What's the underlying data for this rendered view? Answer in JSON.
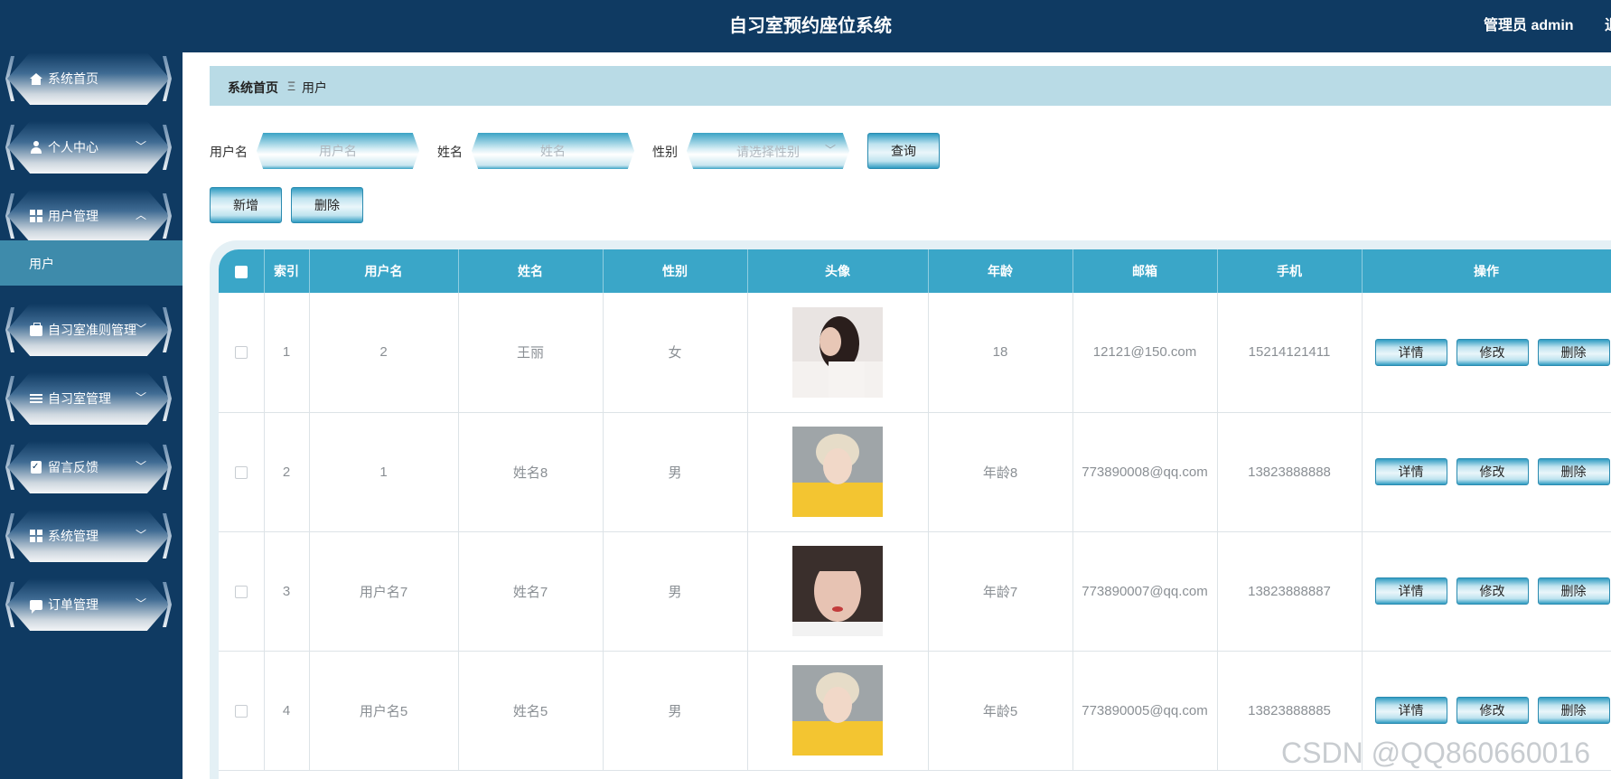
{
  "header": {
    "title": "自习室预约座位系统",
    "user": "管理员 admin",
    "logout": "退出"
  },
  "sidebar": {
    "items": [
      {
        "label": "系统首页",
        "icon": "home-icon"
      },
      {
        "label": "个人中心",
        "icon": "user-icon"
      },
      {
        "label": "用户管理",
        "icon": "grid-icon"
      },
      {
        "label": "自习室准则管理",
        "icon": "briefcase-icon"
      },
      {
        "label": "自习室管理",
        "icon": "sliders-icon"
      },
      {
        "label": "留言反馈",
        "icon": "clipboard-icon"
      },
      {
        "label": "系统管理",
        "icon": "grid-icon"
      },
      {
        "label": "订单管理",
        "icon": "chat-icon"
      }
    ],
    "submenu": {
      "label": "用户"
    }
  },
  "breadcrumb": {
    "home": "系统首页",
    "separator": "Ξ",
    "current": "用户"
  },
  "search": {
    "username_label": "用户名",
    "username_placeholder": "用户名",
    "name_label": "姓名",
    "name_placeholder": "姓名",
    "gender_label": "性别",
    "gender_placeholder": "请选择性别",
    "query_button": "查询"
  },
  "actions": {
    "add": "新增",
    "delete": "删除"
  },
  "table": {
    "headers": [
      "索引",
      "用户名",
      "姓名",
      "性别",
      "头像",
      "年龄",
      "邮箱",
      "手机",
      "操作"
    ],
    "row_buttons": {
      "detail": "详情",
      "edit": "修改",
      "delete": "删除"
    },
    "rows": [
      {
        "index": "1",
        "username": "2",
        "name": "王丽",
        "gender": "女",
        "age": "18",
        "email": "12121@150.com",
        "phone": "15214121411"
      },
      {
        "index": "2",
        "username": "1",
        "name": "姓名8",
        "gender": "男",
        "age": "年龄8",
        "email": "773890008@qq.com",
        "phone": "13823888888"
      },
      {
        "index": "3",
        "username": "用户名7",
        "name": "姓名7",
        "gender": "男",
        "age": "年龄7",
        "email": "773890007@qq.com",
        "phone": "13823888887"
      },
      {
        "index": "4",
        "username": "用户名5",
        "name": "姓名5",
        "gender": "男",
        "age": "年龄5",
        "email": "773890005@qq.com",
        "phone": "13823888885"
      }
    ]
  },
  "watermark": "CSDN @QQ860660016",
  "colors": {
    "sidebar": "#0f3a62",
    "header": "#0f3a62",
    "breadcrumb": "#b9dbe6",
    "table_header": "#3aa6c8",
    "submenu": "#3e8bab"
  }
}
